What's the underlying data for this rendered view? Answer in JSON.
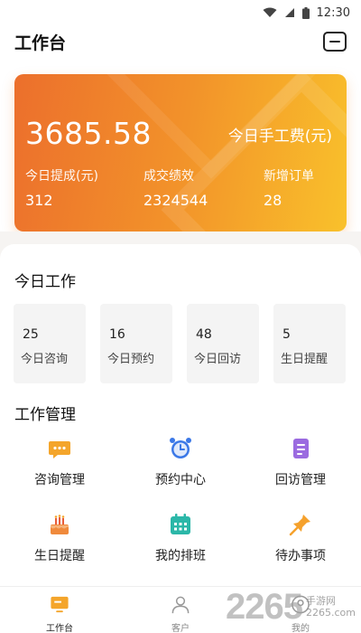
{
  "status_bar": {
    "time": "12:30"
  },
  "header": {
    "title": "工作台"
  },
  "summary": {
    "amount": "3685.58",
    "amount_label": "今日手工费(元)",
    "stats": [
      {
        "label": "今日提成(元)",
        "value": "312"
      },
      {
        "label": "成交绩效",
        "value": "2324544"
      },
      {
        "label": "新增订单",
        "value": "28"
      }
    ]
  },
  "today_work": {
    "title": "今日工作",
    "items": [
      {
        "count": "25",
        "label": "今日咨询"
      },
      {
        "count": "16",
        "label": "今日预约"
      },
      {
        "count": "48",
        "label": "今日回访"
      },
      {
        "count": "5",
        "label": "生日提醒"
      }
    ]
  },
  "management": {
    "title": "工作管理",
    "items": [
      {
        "label": "咨询管理",
        "icon": "chat-icon",
        "color": "#f4a52b"
      },
      {
        "label": "预约中心",
        "icon": "alarm-clock-icon",
        "color": "#3b78e7"
      },
      {
        "label": "回访管理",
        "icon": "notes-icon",
        "color": "#9b6be0"
      },
      {
        "label": "生日提醒",
        "icon": "cake-icon",
        "color": "#f08a3c"
      },
      {
        "label": "我的排班",
        "icon": "calendar-icon",
        "color": "#2bb7a8"
      },
      {
        "label": "待办事项",
        "icon": "pin-icon",
        "color": "#f5a12c"
      }
    ]
  },
  "bottom_nav": {
    "items": [
      {
        "label": "工作台",
        "icon": "monitor-icon"
      },
      {
        "label": "客户",
        "icon": "person-icon"
      },
      {
        "label": "我的",
        "icon": "profile-icon"
      }
    ]
  },
  "watermark": {
    "number": "2265",
    "text": "手游网",
    "url": "2265.com"
  }
}
